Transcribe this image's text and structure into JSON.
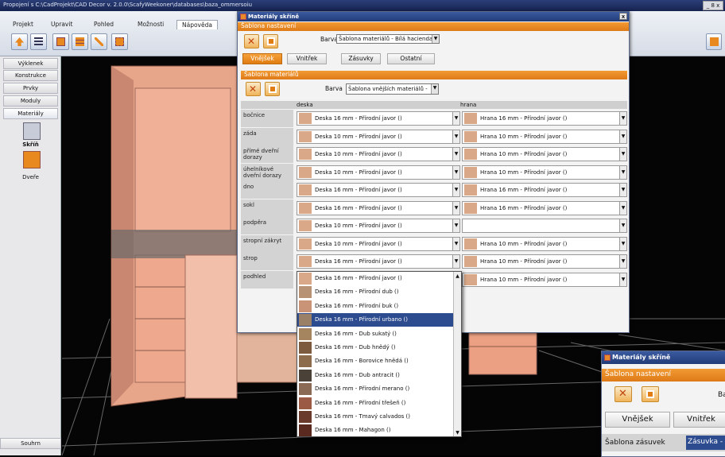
{
  "app": {
    "title": "Propojení s C:\\CadProjekt\\CAD Decor v. 2.0.0\\ScafyWeekoner\\databases\\baza_ommersoiu",
    "controls": "_ 8 x"
  },
  "ribbon": {
    "tabs": [
      "Projekt",
      "Upravit",
      "Pohled",
      "Možnosti",
      "Nápověda"
    ],
    "active_tab": "Nápověda"
  },
  "left_panel": {
    "items": [
      "Výklenek",
      "Konstrukce",
      "Prvky",
      "Moduly",
      "Materiály"
    ],
    "tools": [
      {
        "label": "Skříň"
      },
      {
        "label": "Dveře"
      }
    ],
    "bottom": "Souhrn"
  },
  "dialog": {
    "title": "Materiály skříně",
    "close": "x",
    "section_template": "Šablona nastavení",
    "barva_label": "Barva",
    "template_value": "Šablona materiálů - Bílá hacienda",
    "tabs": [
      "Vnějšek",
      "Vnitřek",
      "Zásuvky",
      "Ostatní"
    ],
    "active_tab": "Vnějšek",
    "section_materials": "Šablona materiálů",
    "barva_label2": "Barva",
    "materials_value": "Šablona vnějších materiálů -",
    "col_deska": "deska",
    "col_hrana": "hrana",
    "rows": [
      {
        "label": "bočnice",
        "deska": "Deska 16 mm - Přírodní javor ()",
        "hrana": "Hrana 16 mm - Přírodní javor ()"
      },
      {
        "label": "záda",
        "deska": "Deska 10 mm - Přírodní javor ()",
        "hrana": "Hrana 10 mm - Přírodní javor ()"
      },
      {
        "label": "přímé dveřní dorazy",
        "deska": "Deska 10 mm - Přírodní javor ()",
        "hrana": "Hrana 10 mm - Přírodní javor ()"
      },
      {
        "label": "úhelníkové dveřní dorazy",
        "deska": "Deska 10 mm - Přírodní javor ()",
        "hrana": "Hrana 10 mm - Přírodní javor ()"
      },
      {
        "label": "dno",
        "deska": "Deska 16 mm - Přírodní javor ()",
        "hrana": "Hrana 16 mm - Přírodní javor ()"
      },
      {
        "label": "sokl",
        "deska": "Deska 16 mm - Přírodní javor ()",
        "hrana": "Hrana 16 mm - Přírodní javor ()"
      },
      {
        "label": "podpěra",
        "deska": "Deska 10 mm - Přírodní javor ()",
        "hrana": ""
      },
      {
        "label": "stropní zákryt",
        "deska": "Deska 10 mm - Přírodní javor ()",
        "hrana": "Hrana 10 mm - Přírodní javor ()"
      },
      {
        "label": "strop",
        "deska": "Deska 16 mm - Přírodní javor ()",
        "hrana": "Hrana 10 mm - Přírodní javor ()"
      },
      {
        "label": "podhled",
        "deska": "",
        "hrana": "Hrana 10 mm - Přírodní javor ()"
      }
    ],
    "dropdown": [
      {
        "text": "Deska 16 mm - Přírodní javor ()",
        "color": "#d9a888"
      },
      {
        "text": "Deska 16 mm - Přírodní dub ()",
        "color": "#b89274"
      },
      {
        "text": "Deska 16 mm - Přírodní buk ()",
        "color": "#c99377"
      },
      {
        "text": "Deska 16 mm - Přírodní urbano ()",
        "color": "#9b8068",
        "selected": true
      },
      {
        "text": "Deska 16 mm - Dub sukatý ()",
        "color": "#a4855f"
      },
      {
        "text": "Deska 16 mm - Dub hnědý ()",
        "color": "#7c5a3e"
      },
      {
        "text": "Deska 16 mm - Borovice hnědá ()",
        "color": "#8c6b4d"
      },
      {
        "text": "Deska 16 mm - Dub antracit ()",
        "color": "#4a4139"
      },
      {
        "text": "Deska 16 mm - Přírodní merano ()",
        "color": "#8a6a55"
      },
      {
        "text": "Deska 16 mm - Přírodní třešeň ()",
        "color": "#9b5a44"
      },
      {
        "text": "Deska 16 mm - Tmavý calvados ()",
        "color": "#6a3a2c"
      },
      {
        "text": "Deska 16 mm - Mahagon ()",
        "color": "#5a2a20"
      }
    ]
  },
  "dialog2": {
    "title": "Materiály skříně",
    "section": "Šablona nastavení",
    "barva_label": "Ba",
    "tabs": [
      "Vnějšek",
      "Vnitřek"
    ],
    "row_label": "Šablona zásuvek",
    "row_value": "Zásuvka - I"
  },
  "colors": {
    "accent": "#e8891f",
    "swatch": "#d9a888",
    "title_blue": "#2a4486"
  }
}
